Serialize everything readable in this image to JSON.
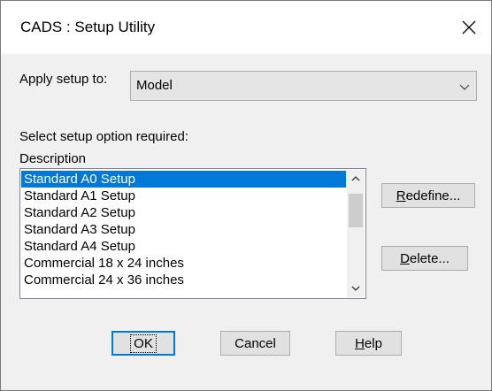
{
  "window": {
    "title": "CADS : Setup Utility",
    "close_glyph": "✕"
  },
  "apply_setup": {
    "label": "Apply setup to:",
    "selected": "Model"
  },
  "select_label": "Select setup option required:",
  "list": {
    "header": "Description",
    "items": [
      {
        "label": "Standard A0 Setup",
        "selected": true
      },
      {
        "label": "Standard A1 Setup",
        "selected": false
      },
      {
        "label": "Standard A2 Setup",
        "selected": false
      },
      {
        "label": "Standard A3 Setup",
        "selected": false
      },
      {
        "label": "Standard A4 Setup",
        "selected": false
      },
      {
        "label": "Commercial 18 x 24 inches",
        "selected": false
      },
      {
        "label": "Commercial 24 x 36 inches",
        "selected": false
      }
    ]
  },
  "buttons": {
    "redefine": {
      "mnemonic": "R",
      "rest": "edefine..."
    },
    "delete": {
      "mnemonic": "D",
      "rest": "elete..."
    },
    "ok": "OK",
    "cancel": "Cancel",
    "help": {
      "mnemonic": "H",
      "rest": "elp"
    }
  },
  "colors": {
    "selection": "#0078d7",
    "dialog_bg": "#f0f0f0"
  }
}
